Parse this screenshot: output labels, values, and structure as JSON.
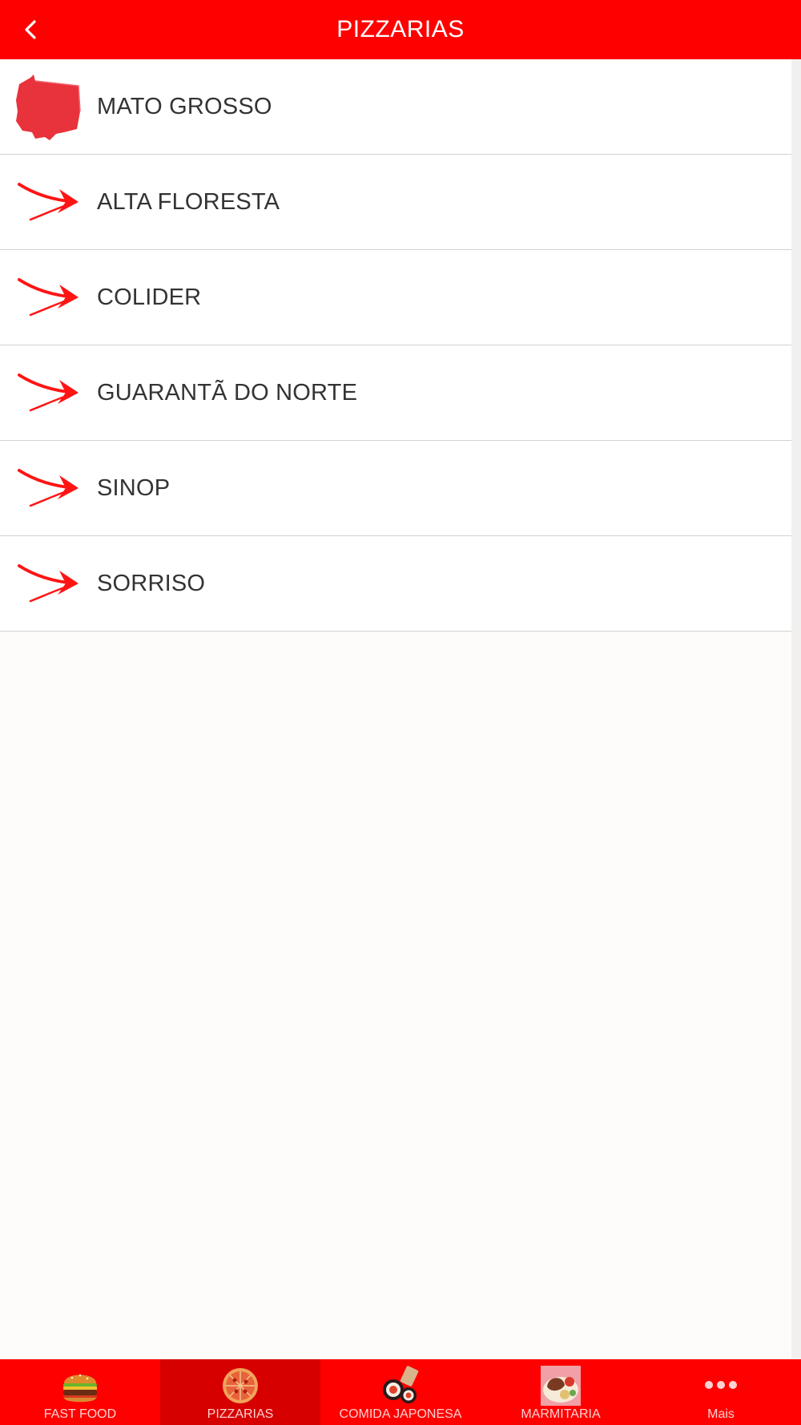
{
  "header": {
    "title": "PIZZARIAS",
    "back_icon": "chevron-left-icon"
  },
  "list": {
    "items": [
      {
        "label": "MATO GROSSO",
        "icon": "state-map-icon"
      },
      {
        "label": "ALTA FLORESTA",
        "icon": "red-arrow-icon"
      },
      {
        "label": "COLIDER",
        "icon": "red-arrow-icon"
      },
      {
        "label": "GUARANTÃ DO NORTE",
        "icon": "red-arrow-icon"
      },
      {
        "label": "SINOP",
        "icon": "red-arrow-icon"
      },
      {
        "label": "SORRISO",
        "icon": "red-arrow-icon"
      }
    ]
  },
  "tabbar": {
    "tabs": [
      {
        "label": "FAST FOOD",
        "icon": "burger-icon",
        "active": false
      },
      {
        "label": "PIZZARIAS",
        "icon": "pizza-icon",
        "active": true
      },
      {
        "label": "COMIDA JAPONESA",
        "icon": "sushi-icon",
        "active": false
      },
      {
        "label": "MARMITARIA",
        "icon": "meal-box-icon",
        "active": false
      },
      {
        "label": "Mais",
        "icon": "more-dots-icon",
        "active": false
      }
    ]
  },
  "colors": {
    "primary": "#ff0000",
    "active_tab": "#d60000",
    "text": "#333333",
    "background": "#fdfcfb",
    "divider": "#d2d2d2"
  }
}
